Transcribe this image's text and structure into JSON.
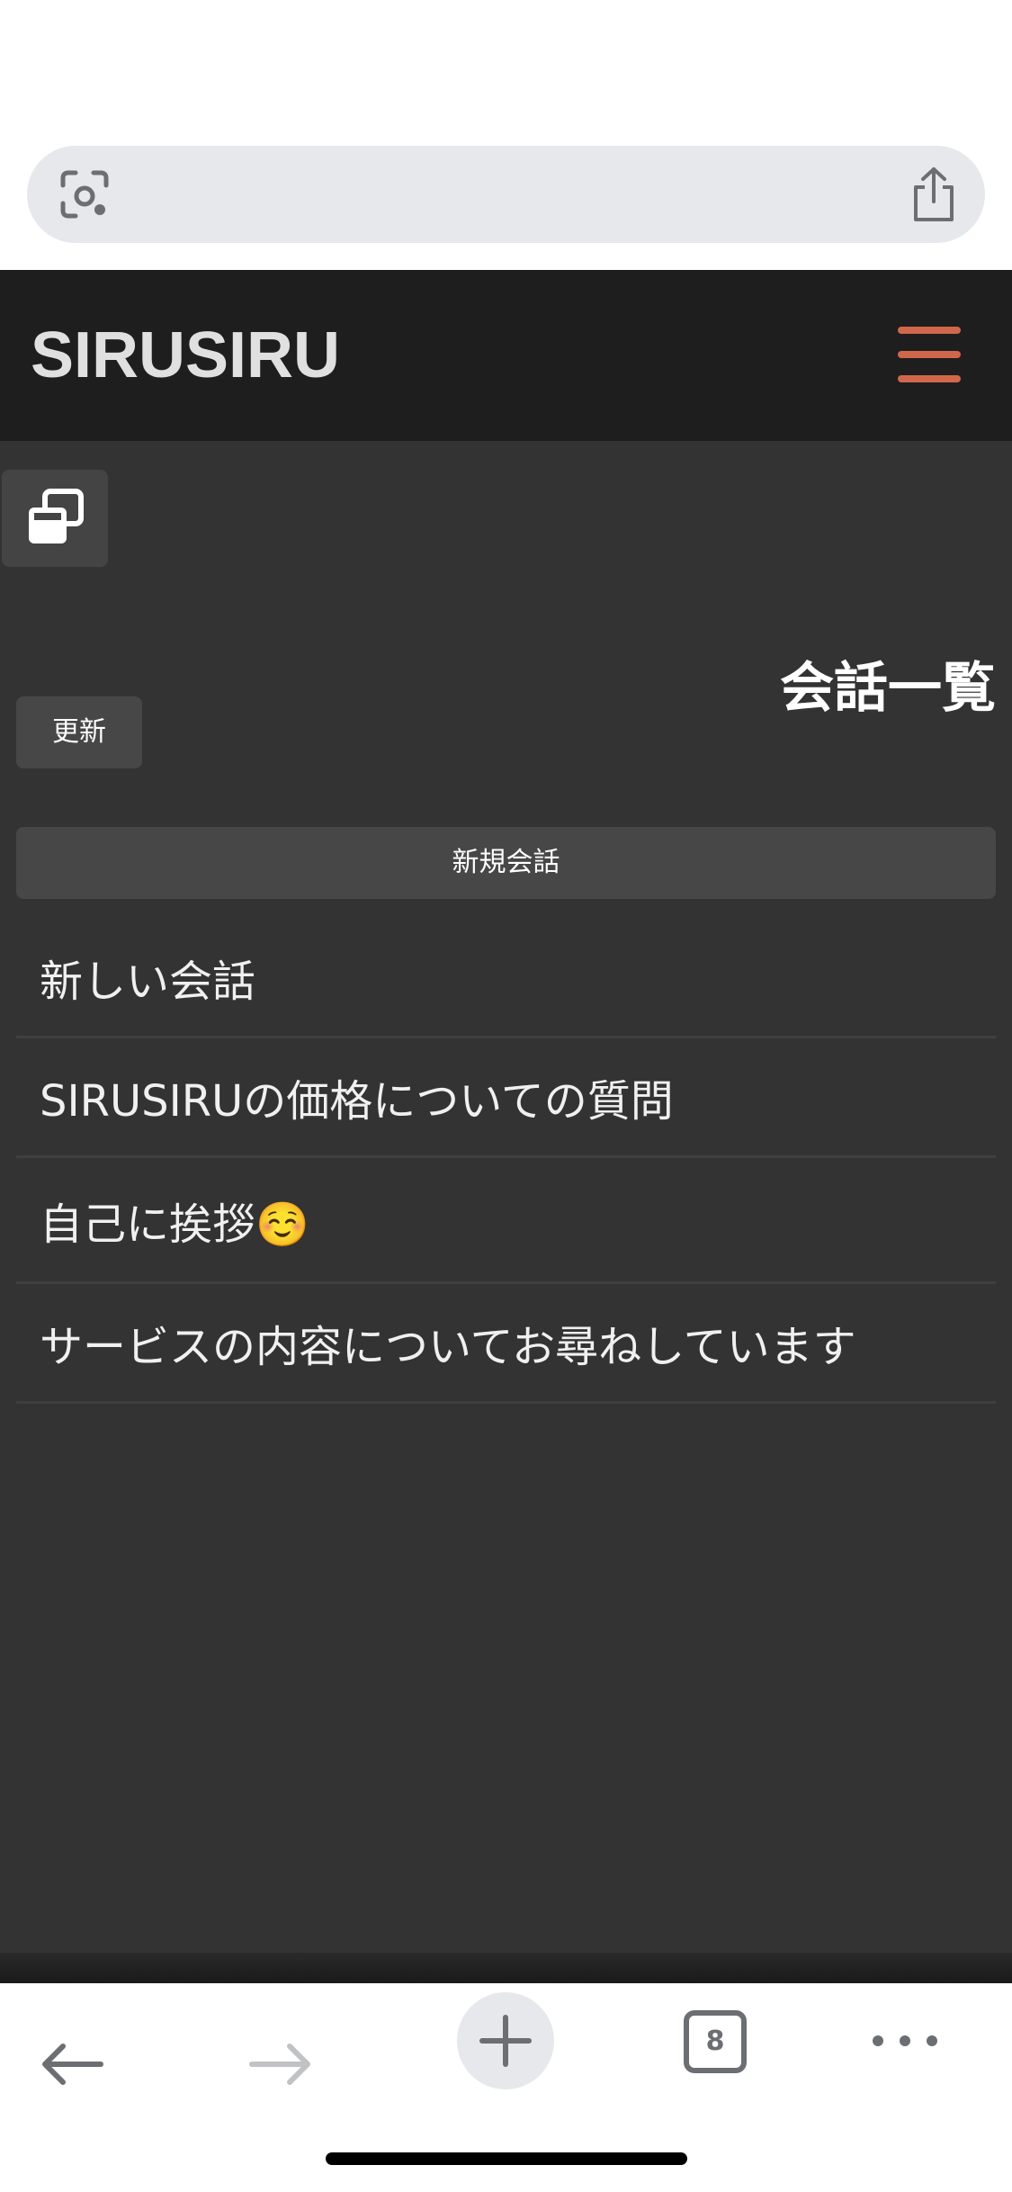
{
  "browser": {
    "lens_icon": "camera-lens-icon",
    "share_icon": "share-icon",
    "toolbar": {
      "back_icon": "arrow-left-icon",
      "forward_icon": "arrow-right-icon",
      "new_tab_icon": "plus-icon",
      "tab_count": "8",
      "more_icon": "more-horizontal-icon"
    }
  },
  "app": {
    "logo": "SIRUSIRU",
    "menu_icon": "hamburger-menu-icon",
    "sidebar_toggle_icon": "window-stack-icon",
    "page_title": "会話一覧",
    "refresh_label": "更新",
    "new_conversation_label": "新規会話",
    "conversations": [
      {
        "title": "新しい会話"
      },
      {
        "title": "SIRUSIRUの価格についての質問"
      },
      {
        "title": "自己に挨拶☺️"
      },
      {
        "title": "サービスの内容についてお尋ねしています"
      }
    ]
  },
  "colors": {
    "header_bg": "#1e1e1e",
    "main_bg": "#333333",
    "button_bg": "#474747",
    "accent": "#d0674a",
    "text": "#ffffff"
  }
}
